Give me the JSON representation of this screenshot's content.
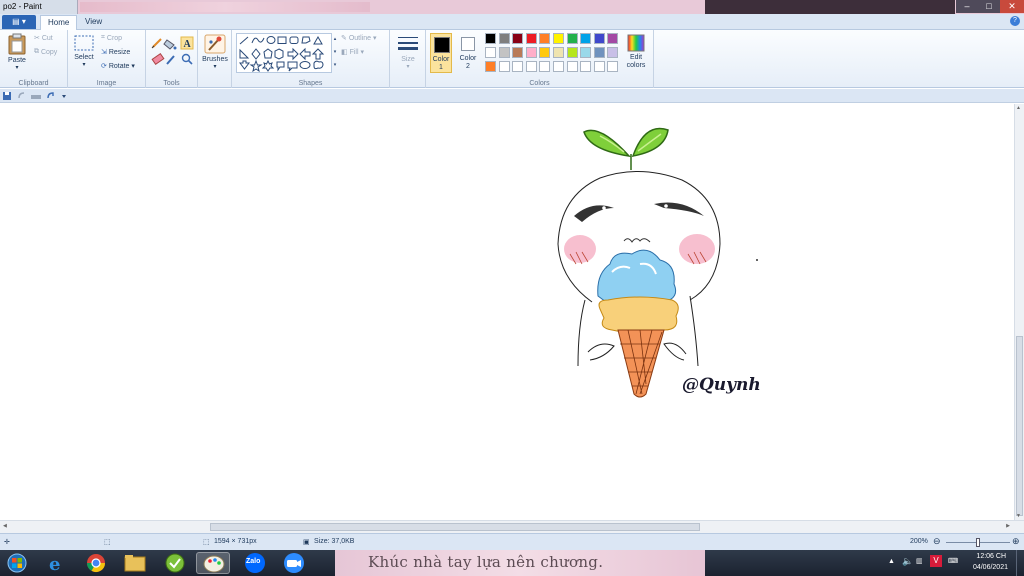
{
  "window": {
    "title": "po2 - Paint",
    "controls": {
      "minimize": "–",
      "maximize": "□",
      "close": "✕"
    }
  },
  "tabs": {
    "file_glyph": "▤ ▾",
    "home": "Home",
    "view": "View",
    "help": "?"
  },
  "ribbon": {
    "clipboard": {
      "label": "Clipboard",
      "paste": "Paste",
      "cut": "Cut",
      "copy": "Copy"
    },
    "image": {
      "label": "Image",
      "select": "Select",
      "crop": "Crop",
      "resize": "Resize",
      "rotate": "Rotate ▾"
    },
    "tools": {
      "label": "Tools"
    },
    "brushes": {
      "label": "Brushes"
    },
    "shapes": {
      "label": "Shapes",
      "outline": "Outline ▾",
      "fill": "Fill ▾"
    },
    "size": {
      "label": "Size"
    },
    "colors": {
      "label": "Colors",
      "color1": "Color 1",
      "color2": "Color 2",
      "edit": "Edit colors",
      "palette_row1": [
        "#000000",
        "#7f7f7f",
        "#880015",
        "#ed1c24",
        "#ff7f27",
        "#fff200",
        "#22b14c",
        "#00a2e8",
        "#3f48cc",
        "#a349a4"
      ],
      "palette_row2": [
        "#ffffff",
        "#c3c3c3",
        "#b97a57",
        "#ffaec9",
        "#ffc90e",
        "#efe4b0",
        "#b5e61d",
        "#99d9ea",
        "#7092be",
        "#c8bfe7"
      ],
      "palette_row3": [
        "#ff7f27",
        "#ffffff",
        "#ffffff",
        "#ffffff",
        "#ffffff",
        "#ffffff",
        "#ffffff",
        "#ffffff",
        "#ffffff",
        "#ffffff"
      ]
    }
  },
  "canvas": {
    "signature": "@Quynh"
  },
  "status": {
    "dimensions": "1594 × 731px",
    "size": "Size: 37,0KB",
    "zoom": "200%"
  },
  "taskbar": {
    "banner_text": "Khúc nhà tay lựa nên chương.",
    "time": "12:06 CH",
    "date": "04/06/2021",
    "zalo": "Zalo"
  }
}
